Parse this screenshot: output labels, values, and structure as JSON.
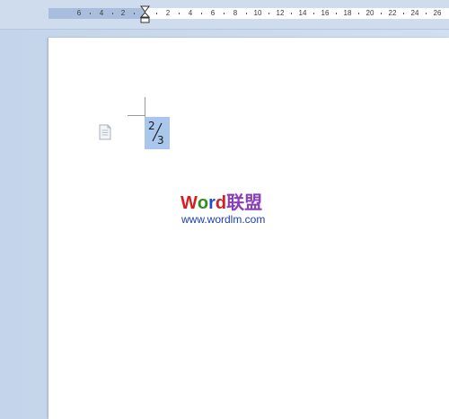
{
  "ruler": {
    "left_labels": [
      "6",
      "4",
      "2"
    ],
    "right_labels": [
      "2",
      "4",
      "6",
      "8",
      "10",
      "12",
      "14",
      "16",
      "18",
      "20",
      "22",
      "24",
      "26"
    ]
  },
  "document": {
    "fraction_numerator": "2",
    "fraction_denominator": "3",
    "watermark": {
      "title_chars": [
        {
          "char": "W",
          "color": "#d42020"
        },
        {
          "char": "o",
          "color": "#2f8f1f"
        },
        {
          "char": "r",
          "color": "#1f4fc8"
        },
        {
          "char": "d",
          "color": "#d42020"
        },
        {
          "char": "联",
          "color": "#8a3fb5"
        },
        {
          "char": "盟",
          "color": "#8a3fb5"
        }
      ],
      "url": "www.wordlm.com"
    }
  },
  "colors": {
    "selection": "#a9c6ec",
    "ruler_margin": "#a8bedc"
  },
  "icons": [
    "tab-marker-icon",
    "indent-marker-icon",
    "document-icon"
  ]
}
